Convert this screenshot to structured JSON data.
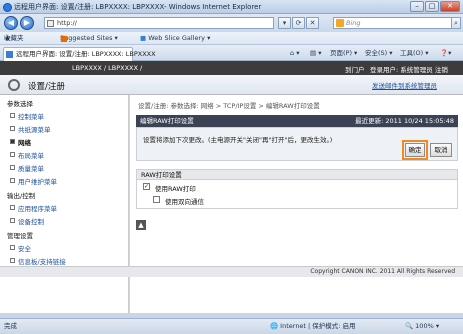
{
  "window": {
    "title": "远程用户界面: 设置/注册: LBPXXXX: LBPXXXX- Windows Internet Explorer",
    "min": "–",
    "max": "□",
    "close": "✕"
  },
  "address_bar": {
    "url": "http://",
    "search_placeholder": "Bing"
  },
  "favorites": {
    "favorites_label": "收藏夹",
    "suggested": "Suggested Sites ▾",
    "webslice": "Web Slice Gallery ▾"
  },
  "tab": {
    "label": "远程用户界面: 设置/注册: LBPXXXX: LBPXXXX"
  },
  "commands": {
    "page": "页面(P) ▾",
    "safety": "安全(S) ▾",
    "tools": "工具(O) ▾",
    "help": "❓▾"
  },
  "page_header": {
    "device": "LBPXXXX / LBPXXXX /",
    "portal": "到门户",
    "user": "登录用户: 系统管理员 注销"
  },
  "sub_header": {
    "title": "设置/注册",
    "mail": "发送邮件到系统管理员"
  },
  "sidebar": {
    "groups": [
      {
        "title": "参数选择",
        "items": [
          "控制菜单",
          "共纸源菜单",
          "网络",
          "布局菜单",
          "质量菜单",
          "用户维护菜单"
        ],
        "active": 2
      },
      {
        "title": "输出/控制",
        "items": [
          "应用程序菜单",
          "设备控制"
        ]
      },
      {
        "title": "管理设置",
        "items": [
          "安全",
          "信息板/支持链接"
        ]
      }
    ]
  },
  "main": {
    "breadcrumb": "设置/注册: 参数选择: 网络 > TCP/IP设置 > 编辑RAW打印设置",
    "panel_title": "编辑RAW打印设置",
    "last_update": "最近更新: 2011 10/24 15:05:48",
    "message": "设置将添加下次更改。(主电源开关\"关闭\"再\"打开\"后，更改生效。)",
    "ok": "确定",
    "cancel": "取消",
    "raw_section": "RAW打印设置",
    "use_raw": "使用RAW打印",
    "use_bidirectional": "使用双向通信",
    "back_icon": "▲",
    "copyright": "Copyright CANON INC. 2011 All Rights Reserved"
  },
  "status_bar": {
    "left": "完成",
    "zone": "Internet | 保护模式: 启用",
    "zoom": "100%"
  }
}
